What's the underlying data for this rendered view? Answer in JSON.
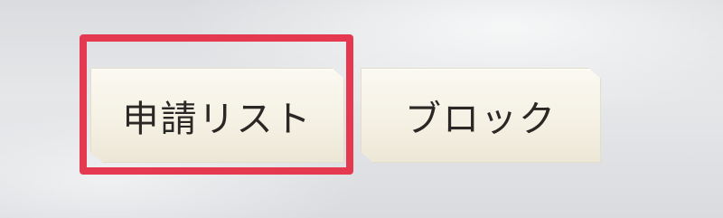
{
  "tabs": [
    {
      "label": "申請リスト",
      "selected": true
    },
    {
      "label": "ブロック",
      "selected": false
    }
  ],
  "colors": {
    "highlight_frame": "#e4394f",
    "tab_fill": "#f4f0e3",
    "tab_text": "#2b2724"
  }
}
